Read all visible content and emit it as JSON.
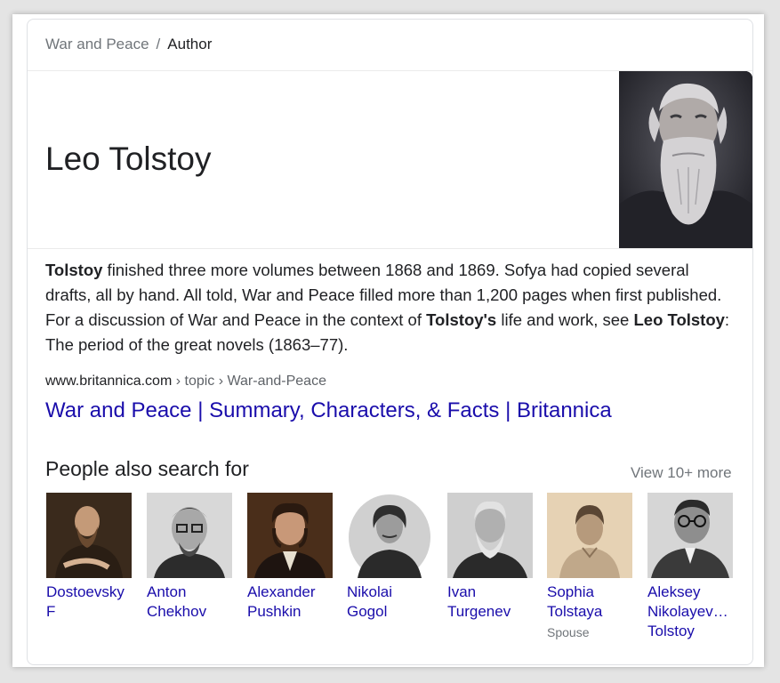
{
  "breadcrumb": {
    "parent": "War and Peace",
    "separator": "/",
    "current": "Author"
  },
  "entity": {
    "title": "Leo Tolstoy"
  },
  "description": {
    "b1": "Tolstoy",
    "t1": " finished three more volumes between 1868 and 1869. Sofya had copied several drafts, all by hand. All told, War and Peace filled more than 1,200 pages when first published. For a discussion of War and Peace in the context of ",
    "b2": "Tolstoy's",
    "t2": " life and work, see ",
    "b3": "Leo Tolstoy",
    "t3": ": The period of the great novels (1863–77)."
  },
  "source": {
    "domain": "www.britannica.com",
    "path": " › topic › War-and-Peace"
  },
  "result_link": "War and Peace | Summary, Characters, & Facts | Britannica",
  "people_also_search": {
    "heading": "People also search for",
    "view_more": "View 10+ more",
    "people": [
      {
        "line1": "Dostoevsky",
        "line2": "F",
        "line3": "",
        "sub": ""
      },
      {
        "line1": "Anton",
        "line2": "Chekhov",
        "line3": "",
        "sub": ""
      },
      {
        "line1": "Alexander",
        "line2": "Pushkin",
        "line3": "",
        "sub": ""
      },
      {
        "line1": "Nikolai",
        "line2": "Gogol",
        "line3": "",
        "sub": ""
      },
      {
        "line1": "Ivan",
        "line2": "Turgenev",
        "line3": "",
        "sub": ""
      },
      {
        "line1": "Sophia",
        "line2": "Tolstaya",
        "line3": "",
        "sub": "Spouse"
      },
      {
        "line1": "Aleksey",
        "line2": "Nikolayev…",
        "line3": "Tolstoy",
        "sub": ""
      }
    ]
  },
  "colors": {
    "link": "#1a0dab",
    "text": "#202124",
    "muted": "#70757a",
    "border": "#dfe1e5"
  }
}
